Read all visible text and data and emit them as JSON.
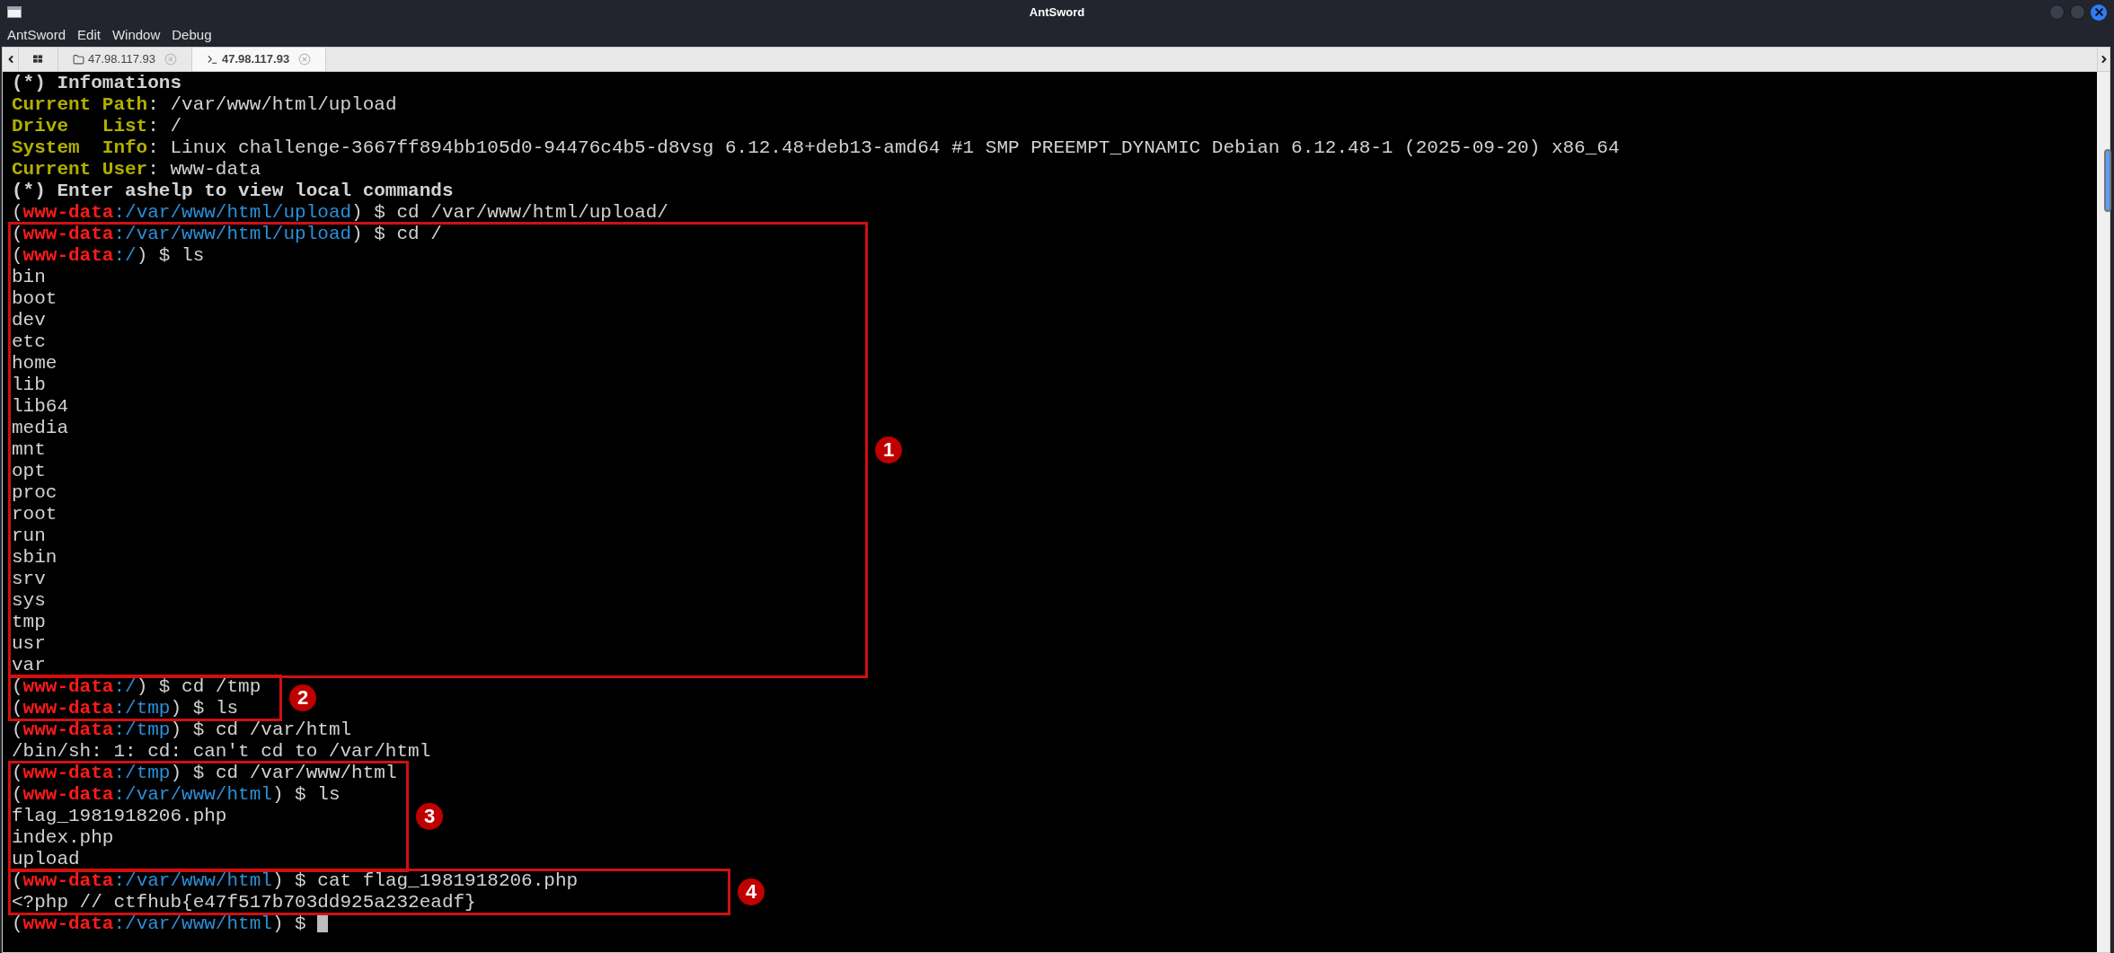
{
  "window": {
    "title": "AntSword"
  },
  "menu": [
    "AntSword",
    "Edit",
    "Window",
    "Debug"
  ],
  "tabs": [
    {
      "kind": "home",
      "selected": false
    },
    {
      "kind": "files",
      "label": "47.98.117.93",
      "selected": false
    },
    {
      "kind": "terminal",
      "label": "47.98.117.93",
      "selected": true
    }
  ],
  "terminal": {
    "blocks": [
      {
        "kind": "plain",
        "lines": [
          {
            "kind": "heading",
            "text": "(*) Infomations"
          },
          {
            "kind": "info",
            "label": "Current Path",
            "rest": ": /var/www/html/upload"
          },
          {
            "kind": "info",
            "label": "Drive   List",
            "rest": ": /"
          },
          {
            "kind": "info",
            "label": "System  Info",
            "rest": ": Linux challenge-3667ff894bb105d0-94476c4b5-d8vsg 6.12.48+deb13-amd64 #1 SMP PREEMPT_DYNAMIC Debian 6.12.48-1 (2025-09-20) x86_64"
          },
          {
            "kind": "info",
            "label": "Current User",
            "rest": ": www-data"
          },
          {
            "kind": "heading",
            "text": "(*) Enter ashelp to view local commands"
          },
          {
            "kind": "prompt",
            "lead": "(",
            "user": "www-data",
            "sep": ":",
            "path": "/var/www/html/upload",
            "rest": ") $ cd /var/www/html/upload/"
          }
        ]
      },
      {
        "kind": "annotated",
        "label": "1",
        "lines": [
          {
            "kind": "prompt",
            "lead": "(",
            "user": "www-data",
            "sep": ":",
            "path": "/var/www/html/upload",
            "rest": ") $ cd /"
          },
          {
            "kind": "prompt",
            "lead": "(",
            "user": "www-data",
            "sep": ":",
            "path": "/",
            "rest": ") $ ls"
          },
          {
            "kind": "output",
            "text": "bin"
          },
          {
            "kind": "output",
            "text": "boot"
          },
          {
            "kind": "output",
            "text": "dev"
          },
          {
            "kind": "output",
            "text": "etc"
          },
          {
            "kind": "output",
            "text": "home"
          },
          {
            "kind": "output",
            "text": "lib"
          },
          {
            "kind": "output",
            "text": "lib64"
          },
          {
            "kind": "output",
            "text": "media"
          },
          {
            "kind": "output",
            "text": "mnt"
          },
          {
            "kind": "output",
            "text": "opt"
          },
          {
            "kind": "output",
            "text": "proc"
          },
          {
            "kind": "output",
            "text": "root"
          },
          {
            "kind": "output",
            "text": "run"
          },
          {
            "kind": "output",
            "text": "sbin"
          },
          {
            "kind": "output",
            "text": "srv"
          },
          {
            "kind": "output",
            "text": "sys"
          },
          {
            "kind": "output",
            "text": "tmp"
          },
          {
            "kind": "output",
            "text": "usr"
          },
          {
            "kind": "output",
            "text": "var"
          }
        ]
      },
      {
        "kind": "annotated",
        "label": "2",
        "lines": [
          {
            "kind": "prompt",
            "lead": "(",
            "user": "www-data",
            "sep": ":",
            "path": "/",
            "rest": ") $ cd /tmp"
          },
          {
            "kind": "prompt",
            "lead": "(",
            "user": "www-data",
            "sep": ":",
            "path": "/tmp",
            "rest": ") $ ls"
          }
        ]
      },
      {
        "kind": "plain",
        "lines": [
          {
            "kind": "prompt",
            "lead": "(",
            "user": "www-data",
            "sep": ":",
            "path": "/tmp",
            "rest": ") $ cd /var/html"
          },
          {
            "kind": "output",
            "text": "/bin/sh: 1: cd: can't cd to /var/html"
          }
        ]
      },
      {
        "kind": "annotated",
        "label": "3",
        "lines": [
          {
            "kind": "prompt",
            "lead": "(",
            "user": "www-data",
            "sep": ":",
            "path": "/tmp",
            "rest": ") $ cd /var/www/html"
          },
          {
            "kind": "prompt",
            "lead": "(",
            "user": "www-data",
            "sep": ":",
            "path": "/var/www/html",
            "rest": ") $ ls"
          },
          {
            "kind": "output",
            "text": "flag_1981918206.php"
          },
          {
            "kind": "output",
            "text": "index.php"
          },
          {
            "kind": "output",
            "text": "upload"
          }
        ]
      },
      {
        "kind": "annotated",
        "label": "4",
        "lines": [
          {
            "kind": "prompt",
            "lead": "(",
            "user": "www-data",
            "sep": ":",
            "path": "/var/www/html",
            "rest": ") $ cat flag_1981918206.php"
          },
          {
            "kind": "output",
            "text": "<?php // ctfhub{e47f517b703dd925a232eadf}"
          }
        ]
      },
      {
        "kind": "plain",
        "lines": [
          {
            "kind": "prompt",
            "lead": "(",
            "user": "www-data",
            "sep": ":",
            "path": "/var/www/html",
            "rest": ") $ ",
            "cursor": true
          }
        ]
      }
    ]
  }
}
